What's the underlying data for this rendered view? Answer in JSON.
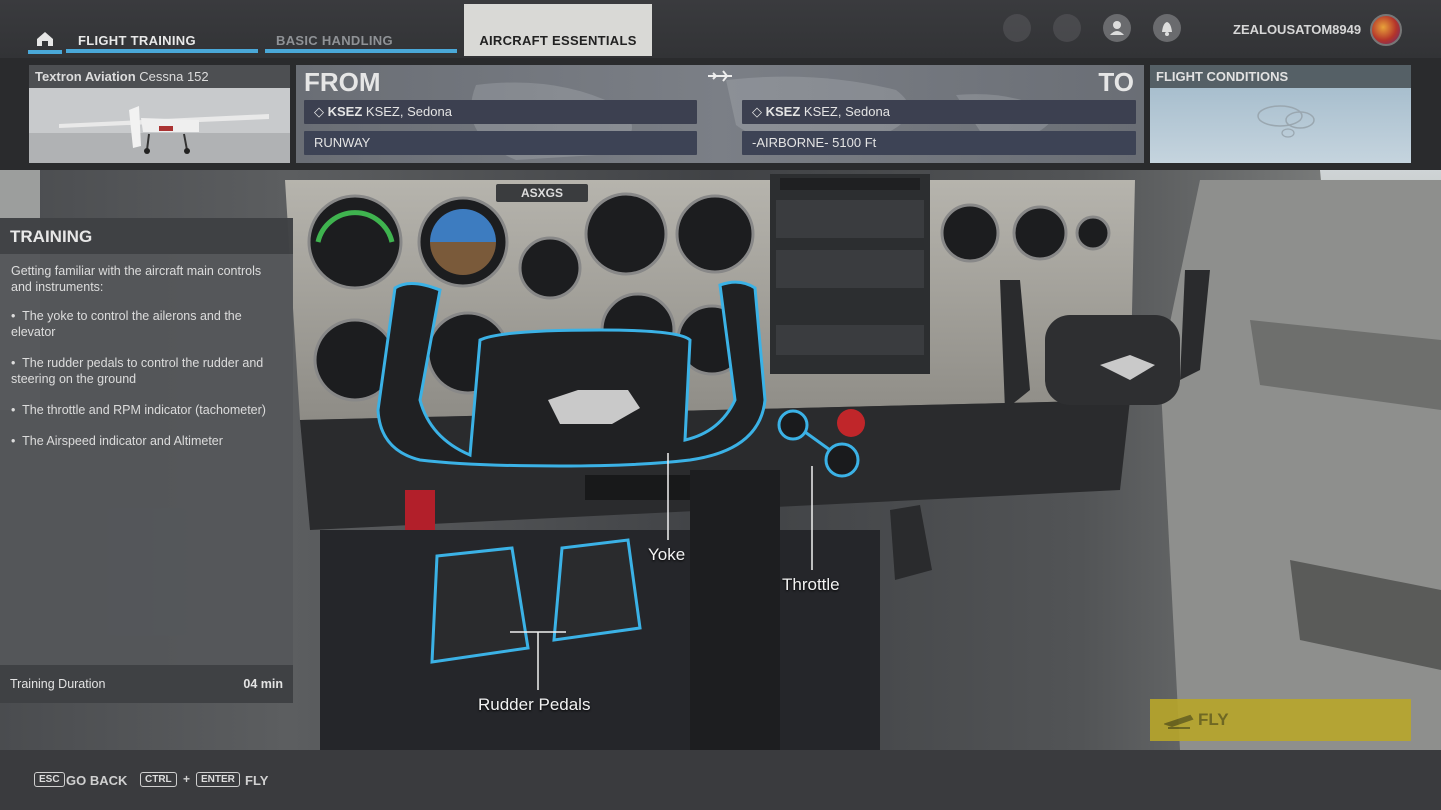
{
  "nav": {
    "tabs": [
      {
        "label": "FLIGHT TRAINING"
      },
      {
        "label": "BASIC HANDLING"
      },
      {
        "label": "AIRCRAFT ESSENTIALS"
      }
    ],
    "username": "ZEALOUSATOM8949"
  },
  "aircraft": {
    "maker": "Textron Aviation",
    "model": "Cessna 152"
  },
  "route": {
    "from_label": "FROM",
    "to_label": "TO",
    "from_code": "KSEZ",
    "from_name": "KSEZ, Sedona",
    "to_code": "KSEZ",
    "to_name": "KSEZ, Sedona",
    "from_start": "RUNWAY",
    "to_start": "-AIRBORNE- 5100 Ft"
  },
  "conditions": {
    "title": "FLIGHT CONDITIONS"
  },
  "cockpit": {
    "placard": "ASXGS"
  },
  "training": {
    "title": "TRAINING",
    "intro": "Getting familiar with the aircraft main controls and instruments:",
    "items": [
      "The yoke to control the ailerons and the elevator",
      "The rudder pedals to control the rudder and steering on the ground",
      "The throttle and RPM indicator (tachometer)",
      "The Airspeed indicator and Altimeter"
    ],
    "duration_label": "Training Duration",
    "duration_value": "04 min"
  },
  "callouts": {
    "yoke": "Yoke",
    "throttle": "Throttle",
    "rudder": "Rudder Pedals"
  },
  "fly_button": "FLY",
  "footer": {
    "esc_key": "ESC",
    "go_back": "GO BACK",
    "ctrl_key": "CTRL",
    "plus": "+",
    "enter_key": "ENTER",
    "fly": "FLY"
  },
  "colors": {
    "accent": "#4aa8d8",
    "fly": "#b8a62a",
    "highlight": "#3bb2e6"
  }
}
